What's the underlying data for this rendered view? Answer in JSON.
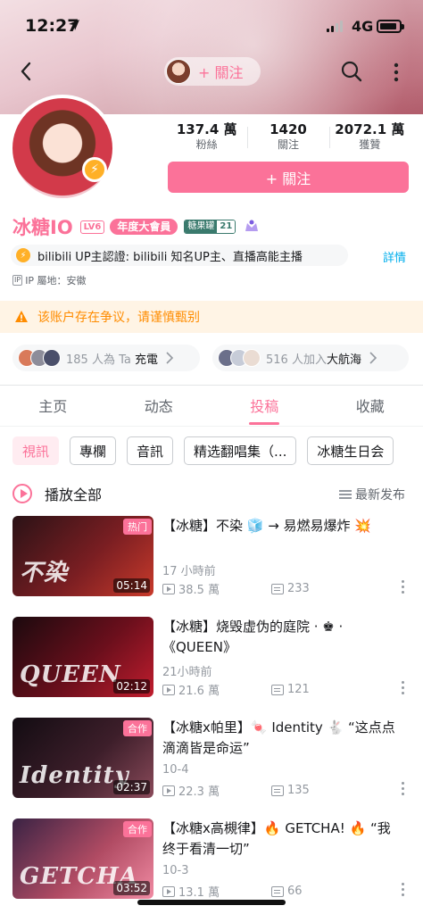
{
  "status_bar": {
    "time": "12:27",
    "network": "4G"
  },
  "header": {
    "follow_label": "+ 關注"
  },
  "profile": {
    "stats": [
      {
        "value": "137.4 萬",
        "label": "粉絲"
      },
      {
        "value": "1420",
        "label": "關注"
      },
      {
        "value": "2072.1 萬",
        "label": "獲贊"
      }
    ],
    "follow_button": "+ 關注",
    "username": "冰糖IO",
    "level": "LV6",
    "vip_label": "年度大會員",
    "fan_medal_name": "糖果罐",
    "fan_medal_level": "21",
    "avatar_badge": "⚡",
    "certification": "bilibili UP主認證: bilibili 知名UP主、直播高能主播",
    "details_link": "詳情",
    "ip_icon": "IP",
    "ip_location": "IP 屬地：安徽"
  },
  "warning": {
    "text": "该账户存在争议，请谨慎甄别"
  },
  "charge": {
    "count_text": "185 人為 Ta ",
    "action": "充電"
  },
  "fleet": {
    "count_text": "516 人加入",
    "action": "大航海"
  },
  "tabs": [
    {
      "label": "主页",
      "active": false
    },
    {
      "label": "动态",
      "active": false
    },
    {
      "label": "投稿",
      "active": true
    },
    {
      "label": "收藏",
      "active": false
    }
  ],
  "chips": [
    {
      "label": "視訊",
      "active": true
    },
    {
      "label": "專欄",
      "active": false
    },
    {
      "label": "音訊",
      "active": false
    },
    {
      "label": "精选翻唱集（...",
      "active": false
    },
    {
      "label": "冰糖生日会",
      "active": false
    }
  ],
  "list_header": {
    "play_all": "播放全部",
    "sort": "最新发布"
  },
  "videos": [
    {
      "title": "【冰糖】不染 🧊 → 易燃易爆炸 💥",
      "date": "17 小時前",
      "views": "38.5 萬",
      "danmaku": "233",
      "duration": "05:14",
      "tag": "热门",
      "thumb_text": "不染",
      "colors": [
        "#2a1216",
        "#7a1e22",
        "#c83a2b"
      ]
    },
    {
      "title": "【冰糖】烧毁虚伪的庭院 · ♚ · 《QUEEN》",
      "date": "21小時前",
      "views": "21.6 萬",
      "danmaku": "121",
      "duration": "02:12",
      "tag": "",
      "thumb_text": "QUEEN",
      "colors": [
        "#1b0a0e",
        "#6b0f1c",
        "#c01d2e"
      ]
    },
    {
      "title": "【冰糖x帕里】🍬 Identity 🐇 “这点点滴滴皆是命运”",
      "date": "10-4",
      "views": "22.3 萬",
      "danmaku": "135",
      "duration": "02:37",
      "tag": "合作",
      "thumb_text": "Identity",
      "colors": [
        "#120c12",
        "#3d1e2a",
        "#8a4a5a"
      ]
    },
    {
      "title": "【冰糖x高槻律】🔥 GETCHA! 🔥 “我终于看清一切”",
      "date": "10-3",
      "views": "13.1 萬",
      "danmaku": "66",
      "duration": "03:52",
      "tag": "合作",
      "thumb_text": "GETCHA",
      "colors": [
        "#3a2344",
        "#b04b63",
        "#f08aa2"
      ]
    }
  ],
  "colors": {
    "accent": "#fb7299",
    "link": "#00aeec",
    "warning": "#ff8c00"
  }
}
